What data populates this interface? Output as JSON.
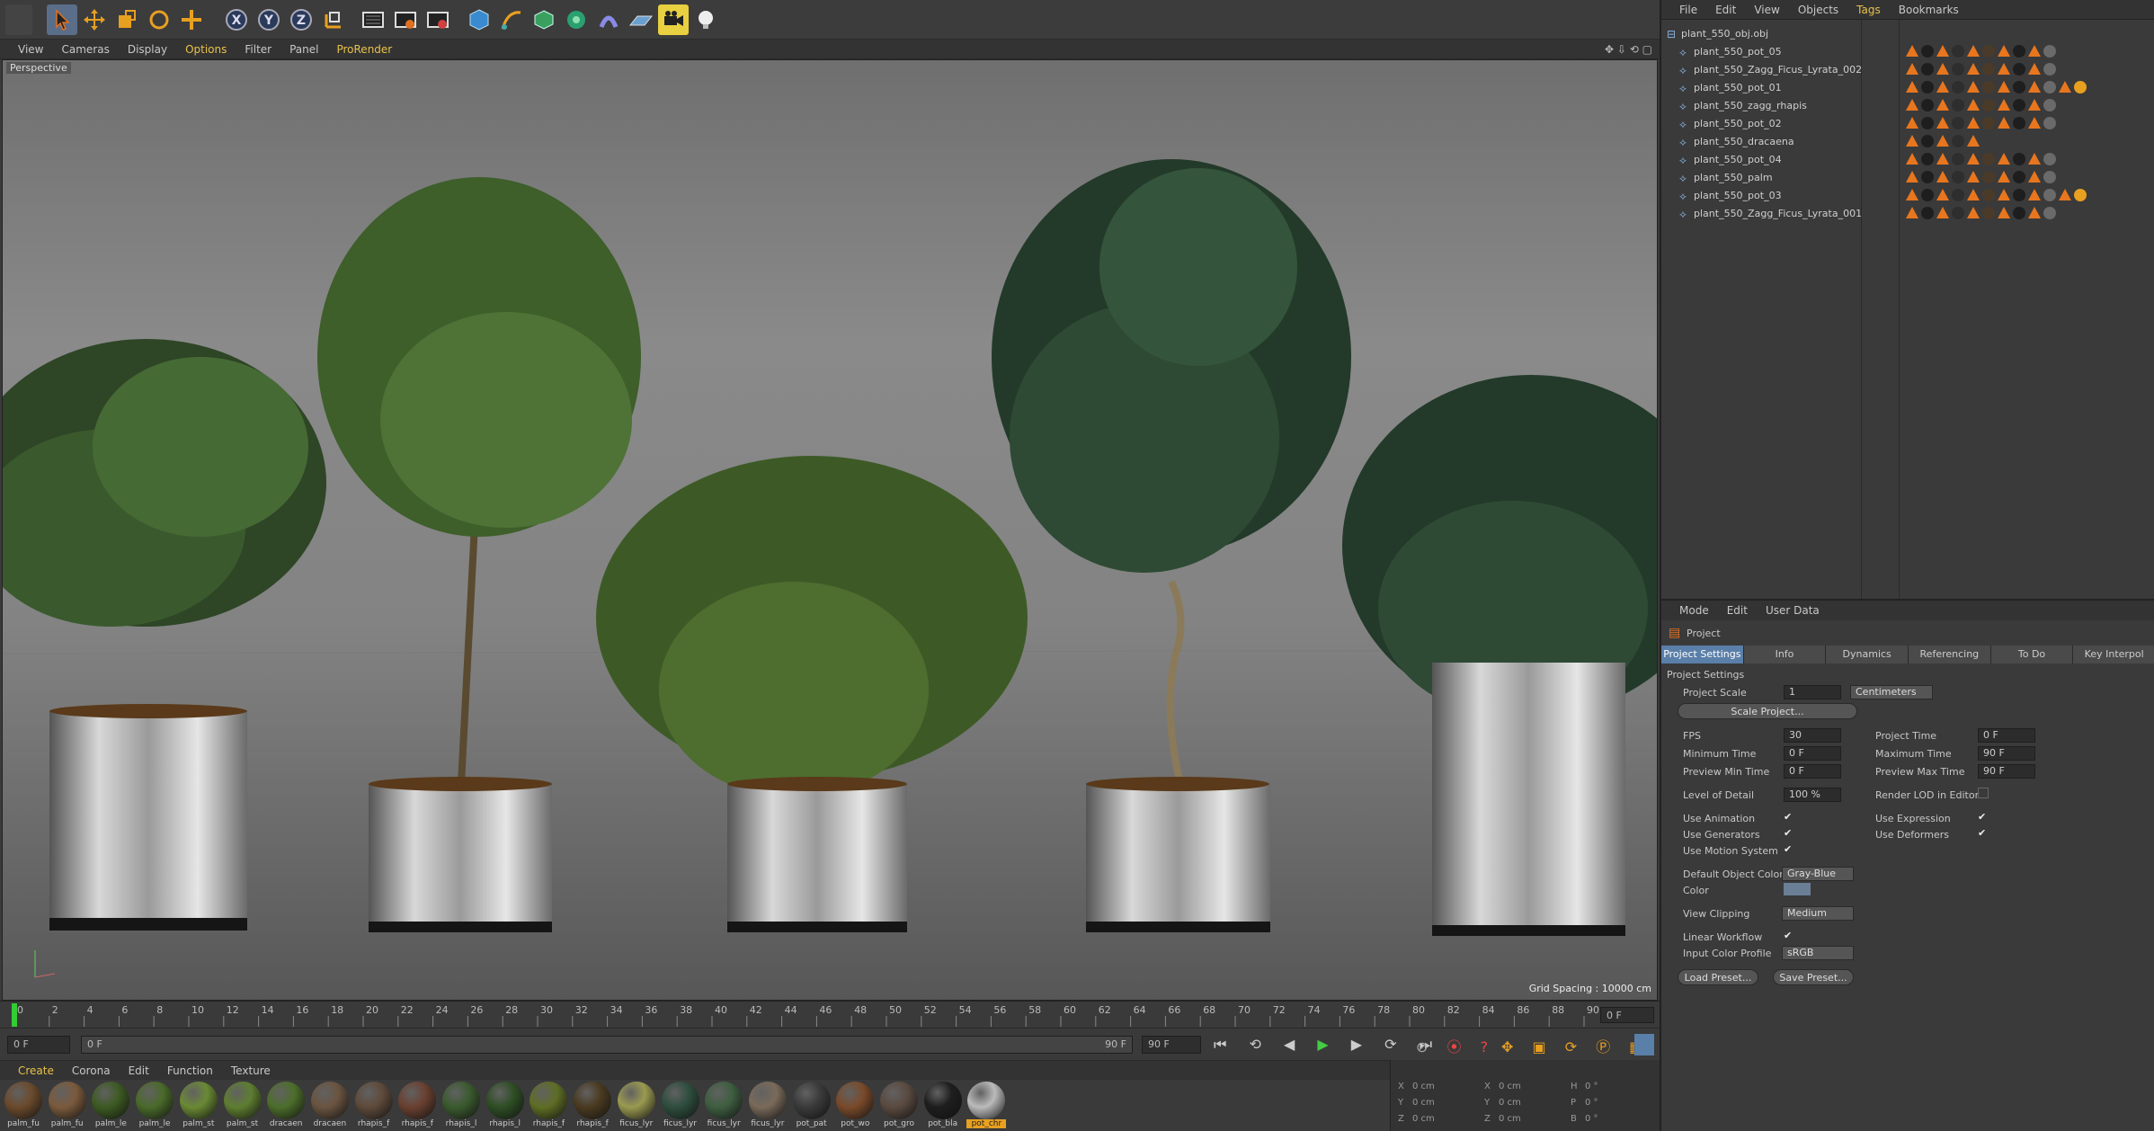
{
  "viewport_menu": [
    "View",
    "Cameras",
    "Display",
    "Options",
    "Filter",
    "Panel",
    "ProRender"
  ],
  "viewport": {
    "label": "Perspective",
    "grid_spacing": "Grid Spacing : 10000 cm"
  },
  "timeline": {
    "ticks": [
      "0",
      "2",
      "4",
      "6",
      "8",
      "10",
      "12",
      "14",
      "16",
      "18",
      "20",
      "22",
      "24",
      "26",
      "28",
      "30",
      "32",
      "34",
      "36",
      "38",
      "40",
      "42",
      "44",
      "46",
      "48",
      "50",
      "52",
      "54",
      "56",
      "58",
      "60",
      "62",
      "64",
      "66",
      "68",
      "70",
      "72",
      "74",
      "76",
      "78",
      "80",
      "82",
      "84",
      "86",
      "88",
      "90"
    ],
    "current": "0 F"
  },
  "frames": {
    "start": "0 F",
    "range_start": "0 F",
    "range_end": "90 F",
    "end": "90 F"
  },
  "material_menu": [
    "Create",
    "Corona",
    "Edit",
    "Function",
    "Texture"
  ],
  "materials": [
    {
      "label": "palm_fu",
      "color": "#6b4a2c"
    },
    {
      "label": "palm_fu",
      "color": "#7b5a3c"
    },
    {
      "label": "palm_le",
      "color": "#3d5a22"
    },
    {
      "label": "palm_le",
      "color": "#4a6a2a"
    },
    {
      "label": "palm_st",
      "color": "#6a8a34"
    },
    {
      "label": "palm_st",
      "color": "#5e7e30"
    },
    {
      "label": "dracaen",
      "color": "#4c6e2a"
    },
    {
      "label": "dracaen",
      "color": "#6a5440"
    },
    {
      "label": "rhapis_f",
      "color": "#5e4a3a"
    },
    {
      "label": "rhapis_f",
      "color": "#6a4030"
    },
    {
      "label": "rhapis_l",
      "color": "#3a5a2e"
    },
    {
      "label": "rhapis_l",
      "color": "#2e4e24"
    },
    {
      "label": "rhapis_f",
      "color": "#5e6e24"
    },
    {
      "label": "rhapis_f",
      "color": "#4a3a20"
    },
    {
      "label": "ficus_lyr",
      "color": "#9a9a50"
    },
    {
      "label": "ficus_lyr",
      "color": "#2e4e3e"
    },
    {
      "label": "ficus_lyr",
      "color": "#3e5e40"
    },
    {
      "label": "ficus_lyr",
      "color": "#7a6a5a"
    },
    {
      "label": "pot_pat",
      "color": "#3a3a3a"
    },
    {
      "label": "pot_wo",
      "color": "#7a4a2a"
    },
    {
      "label": "pot_gro",
      "color": "#5a4a40"
    },
    {
      "label": "pot_bla",
      "color": "#1e1e1e"
    },
    {
      "label": "pot_chr",
      "color": "#bbbbbb"
    }
  ],
  "coords": {
    "labels": [
      "X",
      "Y",
      "Z",
      "X",
      "Y",
      "Z",
      "H",
      "P",
      "B"
    ],
    "values": [
      "0 cm",
      "0 cm",
      "0 cm",
      "0 cm",
      "0 cm",
      "0 cm",
      "0 °",
      "0 °",
      "0 °"
    ]
  },
  "object_menu": [
    "File",
    "Edit",
    "View",
    "Objects",
    "Tags",
    "Bookmarks"
  ],
  "objects": [
    {
      "name": "plant_550_obj.obj"
    },
    {
      "name": "plant_550_pot_05"
    },
    {
      "name": "plant_550_Zagg_Ficus_Lyrata_002"
    },
    {
      "name": "plant_550_pot_01"
    },
    {
      "name": "plant_550_zagg_rhapis"
    },
    {
      "name": "plant_550_pot_02"
    },
    {
      "name": "plant_550_dracaena"
    },
    {
      "name": "plant_550_pot_04"
    },
    {
      "name": "plant_550_palm"
    },
    {
      "name": "plant_550_pot_03"
    },
    {
      "name": "plant_550_Zagg_Ficus_Lyrata_001"
    }
  ],
  "attr_menu": [
    "Mode",
    "Edit",
    "User Data"
  ],
  "attr": {
    "title": "Project",
    "tabs": [
      "Project Settings",
      "Info",
      "Dynamics",
      "Referencing",
      "To Do",
      "Key Interpol"
    ],
    "section": "Project Settings",
    "project_scale_label": "Project Scale",
    "project_scale": "1",
    "project_scale_unit": "Centimeters",
    "scale_btn": "Scale Project...",
    "fps_label": "FPS",
    "fps": "30",
    "project_time_label": "Project Time",
    "project_time": "0 F",
    "min_time_label": "Minimum Time",
    "min_time": "0 F",
    "max_time_label": "Maximum Time",
    "max_time": "90 F",
    "prev_min_label": "Preview Min Time",
    "prev_min": "0 F",
    "prev_max_label": "Preview Max Time",
    "prev_max": "90 F",
    "lod_label": "Level of Detail",
    "lod": "100 %",
    "render_lod_label": "Render LOD in Editor",
    "use_anim_label": "Use Animation",
    "use_expr_label": "Use Expression",
    "use_gen_label": "Use Generators",
    "use_def_label": "Use Deformers",
    "use_motion_label": "Use Motion System",
    "def_color_label": "Default Object Color",
    "def_color": "Gray-Blue",
    "color_label": "Color",
    "clip_label": "View Clipping",
    "clip": "Medium",
    "linear_label": "Linear Workflow",
    "input_profile_label": "Input Color Profile",
    "input_profile": "sRGB",
    "load_btn": "Load Preset...",
    "save_btn": "Save Preset..."
  }
}
